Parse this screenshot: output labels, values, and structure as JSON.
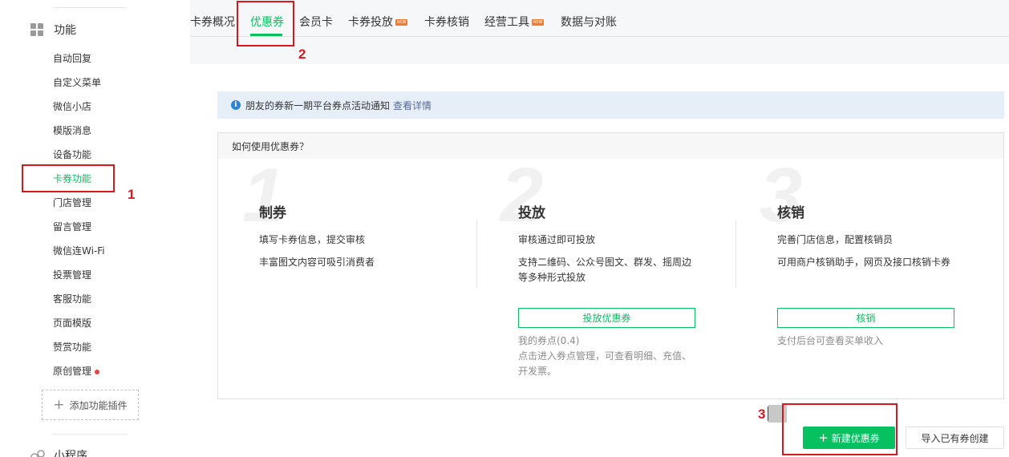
{
  "sidebar": {
    "group_title": "功能",
    "items": [
      {
        "label": "自动回复"
      },
      {
        "label": "自定义菜单"
      },
      {
        "label": "微信小店"
      },
      {
        "label": "模版消息"
      },
      {
        "label": "设备功能"
      },
      {
        "label": "卡券功能"
      },
      {
        "label": "门店管理"
      },
      {
        "label": "留言管理"
      },
      {
        "label": "微信连Wi-Fi"
      },
      {
        "label": "投票管理"
      },
      {
        "label": "客服功能"
      },
      {
        "label": "页面模版"
      },
      {
        "label": "赞赏功能"
      },
      {
        "label": "原创管理"
      }
    ],
    "add_plugin": "添加功能插件",
    "next_group_title": "小程序"
  },
  "tabs": {
    "items": [
      {
        "label": "卡券概况"
      },
      {
        "label": "优惠券"
      },
      {
        "label": "会员卡"
      },
      {
        "label": "卡券投放"
      },
      {
        "label": "卡券核销"
      },
      {
        "label": "经营工具"
      },
      {
        "label": "数据与对账"
      }
    ],
    "new_badge": "NEW"
  },
  "annotations": {
    "one": "1",
    "two": "2",
    "three": "3"
  },
  "notice": {
    "text": "朋友的券新一期平台券点活动通知",
    "link": "查看详情"
  },
  "guide": {
    "header": "如何使用优惠券？",
    "steps": [
      {
        "num": "1",
        "title": "制券",
        "line1": "填写卡券信息，提交审核",
        "line2": "丰富图文内容可吸引消费者"
      },
      {
        "num": "2",
        "title": "投放",
        "line1": "审核通过即可投放",
        "line2a": "支持二维码、公众号图文、群发、摇周边",
        "line2b": "等多种形式投放",
        "button": "投放优惠券",
        "sub1": "我的券点(0.4)",
        "sub2a": "点击进入券点管理，可查看明细、充值、",
        "sub2b": "开发票。"
      },
      {
        "num": "3",
        "title": "核销",
        "line1": "完善门店信息，配置核销员",
        "line2": "可用商户核销助手，网页及接口核销卡券",
        "button": "核销",
        "sub1": "支付后台可查看买单收入"
      }
    ]
  },
  "actions": {
    "create": "新建优惠券",
    "import": "导入已有券创建"
  },
  "colors": {
    "accent": "#07c160",
    "annotation": "#d9181e",
    "link": "#576b95",
    "notice_bg": "#e6eff8"
  }
}
